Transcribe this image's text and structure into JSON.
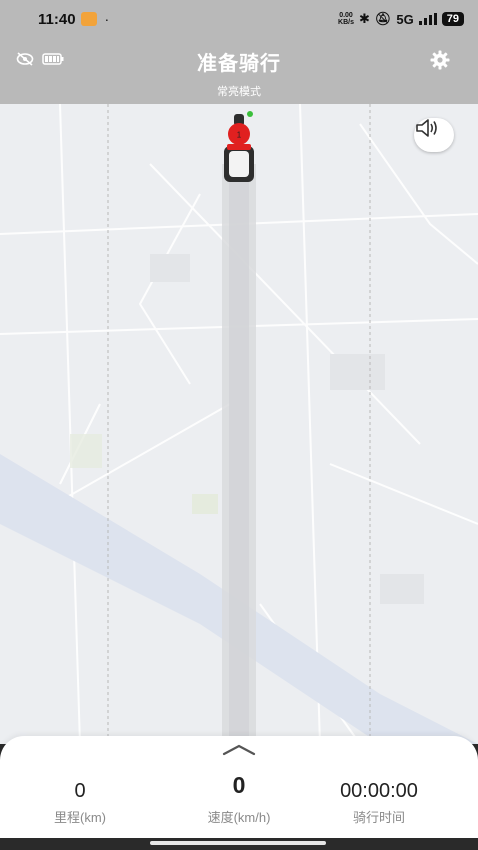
{
  "status_bar": {
    "time": "11:40",
    "dot": "·",
    "net_speed_top": "0.00",
    "net_speed_bottom": "KB/s",
    "network": "5G",
    "battery": "79"
  },
  "header": {
    "title": "准备骑行",
    "subtitle": "常亮模式",
    "left_icons": [
      "eye-off-icon",
      "battery-icon"
    ],
    "right_icon": "gear-icon"
  },
  "map": {
    "sound_icon": "speaker-icon",
    "marker_icon": "motorcycle-rider-icon",
    "colors": {
      "background": "#eceef1",
      "river": "#dde3ee",
      "trail": "#d9dadd",
      "rider": "#e02020"
    }
  },
  "panel": {
    "expand_icon": "chevron-up-icon",
    "distance": {
      "value": "0",
      "label": "里程(km)"
    },
    "speed": {
      "value": "0",
      "label": "速度(km/h)"
    },
    "ride_time": {
      "value": "00:00:00",
      "label": "骑行时间"
    }
  }
}
